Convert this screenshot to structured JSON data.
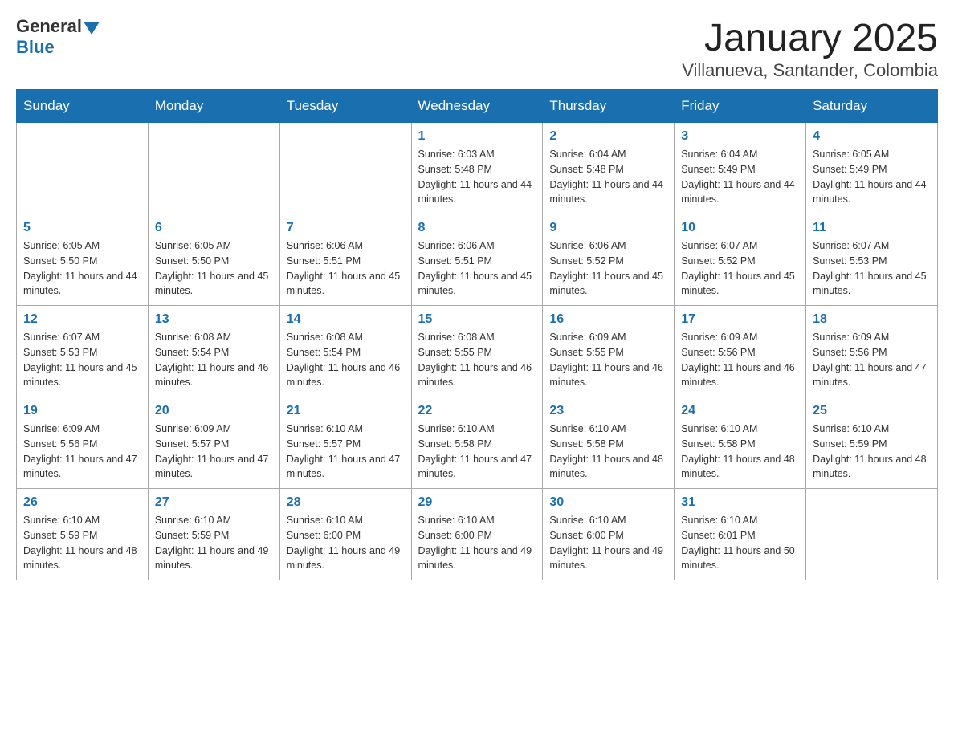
{
  "header": {
    "logo_general": "General",
    "logo_blue": "Blue",
    "month_title": "January 2025",
    "location": "Villanueva, Santander, Colombia"
  },
  "days_of_week": [
    "Sunday",
    "Monday",
    "Tuesday",
    "Wednesday",
    "Thursday",
    "Friday",
    "Saturday"
  ],
  "weeks": [
    [
      {
        "day": "",
        "sunrise": "",
        "sunset": "",
        "daylight": ""
      },
      {
        "day": "",
        "sunrise": "",
        "sunset": "",
        "daylight": ""
      },
      {
        "day": "",
        "sunrise": "",
        "sunset": "",
        "daylight": ""
      },
      {
        "day": "1",
        "sunrise": "Sunrise: 6:03 AM",
        "sunset": "Sunset: 5:48 PM",
        "daylight": "Daylight: 11 hours and 44 minutes."
      },
      {
        "day": "2",
        "sunrise": "Sunrise: 6:04 AM",
        "sunset": "Sunset: 5:48 PM",
        "daylight": "Daylight: 11 hours and 44 minutes."
      },
      {
        "day": "3",
        "sunrise": "Sunrise: 6:04 AM",
        "sunset": "Sunset: 5:49 PM",
        "daylight": "Daylight: 11 hours and 44 minutes."
      },
      {
        "day": "4",
        "sunrise": "Sunrise: 6:05 AM",
        "sunset": "Sunset: 5:49 PM",
        "daylight": "Daylight: 11 hours and 44 minutes."
      }
    ],
    [
      {
        "day": "5",
        "sunrise": "Sunrise: 6:05 AM",
        "sunset": "Sunset: 5:50 PM",
        "daylight": "Daylight: 11 hours and 44 minutes."
      },
      {
        "day": "6",
        "sunrise": "Sunrise: 6:05 AM",
        "sunset": "Sunset: 5:50 PM",
        "daylight": "Daylight: 11 hours and 45 minutes."
      },
      {
        "day": "7",
        "sunrise": "Sunrise: 6:06 AM",
        "sunset": "Sunset: 5:51 PM",
        "daylight": "Daylight: 11 hours and 45 minutes."
      },
      {
        "day": "8",
        "sunrise": "Sunrise: 6:06 AM",
        "sunset": "Sunset: 5:51 PM",
        "daylight": "Daylight: 11 hours and 45 minutes."
      },
      {
        "day": "9",
        "sunrise": "Sunrise: 6:06 AM",
        "sunset": "Sunset: 5:52 PM",
        "daylight": "Daylight: 11 hours and 45 minutes."
      },
      {
        "day": "10",
        "sunrise": "Sunrise: 6:07 AM",
        "sunset": "Sunset: 5:52 PM",
        "daylight": "Daylight: 11 hours and 45 minutes."
      },
      {
        "day": "11",
        "sunrise": "Sunrise: 6:07 AM",
        "sunset": "Sunset: 5:53 PM",
        "daylight": "Daylight: 11 hours and 45 minutes."
      }
    ],
    [
      {
        "day": "12",
        "sunrise": "Sunrise: 6:07 AM",
        "sunset": "Sunset: 5:53 PM",
        "daylight": "Daylight: 11 hours and 45 minutes."
      },
      {
        "day": "13",
        "sunrise": "Sunrise: 6:08 AM",
        "sunset": "Sunset: 5:54 PM",
        "daylight": "Daylight: 11 hours and 46 minutes."
      },
      {
        "day": "14",
        "sunrise": "Sunrise: 6:08 AM",
        "sunset": "Sunset: 5:54 PM",
        "daylight": "Daylight: 11 hours and 46 minutes."
      },
      {
        "day": "15",
        "sunrise": "Sunrise: 6:08 AM",
        "sunset": "Sunset: 5:55 PM",
        "daylight": "Daylight: 11 hours and 46 minutes."
      },
      {
        "day": "16",
        "sunrise": "Sunrise: 6:09 AM",
        "sunset": "Sunset: 5:55 PM",
        "daylight": "Daylight: 11 hours and 46 minutes."
      },
      {
        "day": "17",
        "sunrise": "Sunrise: 6:09 AM",
        "sunset": "Sunset: 5:56 PM",
        "daylight": "Daylight: 11 hours and 46 minutes."
      },
      {
        "day": "18",
        "sunrise": "Sunrise: 6:09 AM",
        "sunset": "Sunset: 5:56 PM",
        "daylight": "Daylight: 11 hours and 47 minutes."
      }
    ],
    [
      {
        "day": "19",
        "sunrise": "Sunrise: 6:09 AM",
        "sunset": "Sunset: 5:56 PM",
        "daylight": "Daylight: 11 hours and 47 minutes."
      },
      {
        "day": "20",
        "sunrise": "Sunrise: 6:09 AM",
        "sunset": "Sunset: 5:57 PM",
        "daylight": "Daylight: 11 hours and 47 minutes."
      },
      {
        "day": "21",
        "sunrise": "Sunrise: 6:10 AM",
        "sunset": "Sunset: 5:57 PM",
        "daylight": "Daylight: 11 hours and 47 minutes."
      },
      {
        "day": "22",
        "sunrise": "Sunrise: 6:10 AM",
        "sunset": "Sunset: 5:58 PM",
        "daylight": "Daylight: 11 hours and 47 minutes."
      },
      {
        "day": "23",
        "sunrise": "Sunrise: 6:10 AM",
        "sunset": "Sunset: 5:58 PM",
        "daylight": "Daylight: 11 hours and 48 minutes."
      },
      {
        "day": "24",
        "sunrise": "Sunrise: 6:10 AM",
        "sunset": "Sunset: 5:58 PM",
        "daylight": "Daylight: 11 hours and 48 minutes."
      },
      {
        "day": "25",
        "sunrise": "Sunrise: 6:10 AM",
        "sunset": "Sunset: 5:59 PM",
        "daylight": "Daylight: 11 hours and 48 minutes."
      }
    ],
    [
      {
        "day": "26",
        "sunrise": "Sunrise: 6:10 AM",
        "sunset": "Sunset: 5:59 PM",
        "daylight": "Daylight: 11 hours and 48 minutes."
      },
      {
        "day": "27",
        "sunrise": "Sunrise: 6:10 AM",
        "sunset": "Sunset: 5:59 PM",
        "daylight": "Daylight: 11 hours and 49 minutes."
      },
      {
        "day": "28",
        "sunrise": "Sunrise: 6:10 AM",
        "sunset": "Sunset: 6:00 PM",
        "daylight": "Daylight: 11 hours and 49 minutes."
      },
      {
        "day": "29",
        "sunrise": "Sunrise: 6:10 AM",
        "sunset": "Sunset: 6:00 PM",
        "daylight": "Daylight: 11 hours and 49 minutes."
      },
      {
        "day": "30",
        "sunrise": "Sunrise: 6:10 AM",
        "sunset": "Sunset: 6:00 PM",
        "daylight": "Daylight: 11 hours and 49 minutes."
      },
      {
        "day": "31",
        "sunrise": "Sunrise: 6:10 AM",
        "sunset": "Sunset: 6:01 PM",
        "daylight": "Daylight: 11 hours and 50 minutes."
      },
      {
        "day": "",
        "sunrise": "",
        "sunset": "",
        "daylight": ""
      }
    ]
  ]
}
